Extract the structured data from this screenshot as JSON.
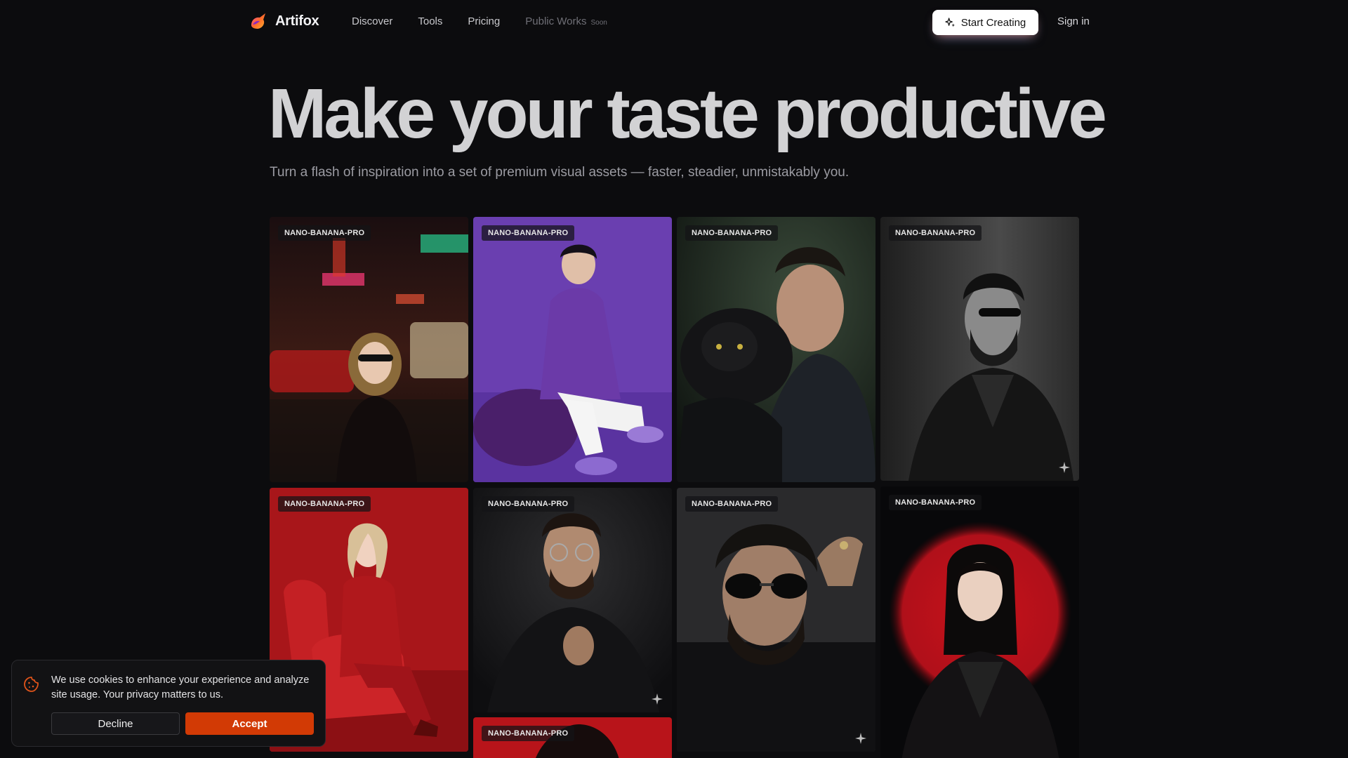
{
  "brand": {
    "name": "Artifox"
  },
  "nav": {
    "links": [
      "Discover",
      "Tools",
      "Pricing"
    ],
    "public_works": "Public Works",
    "soon_badge": "Soon",
    "cta_label": "Start Creating",
    "signin_label": "Sign in"
  },
  "hero": {
    "title": "Make your taste productive",
    "subtitle": "Turn a flash of inspiration into a set of premium visual assets — faster, steadier, unmistakably you."
  },
  "gallery": {
    "items": [
      {
        "model": "NANO-BANANA-PRO",
        "subject": "neon street portrait"
      },
      {
        "model": "NANO-BANANA-PRO",
        "subject": "purple studio portrait"
      },
      {
        "model": "NANO-BANANA-PRO",
        "subject": "man with black panther"
      },
      {
        "model": "NANO-BANANA-PRO",
        "subject": "monochrome leather jacket portrait"
      },
      {
        "model": "NANO-BANANA-PRO",
        "subject": "red chair portrait"
      },
      {
        "model": "NANO-BANANA-PRO",
        "subject": "turtleneck glasses portrait"
      },
      {
        "model": "NANO-BANANA-PRO",
        "subject": "sunglasses portrait"
      },
      {
        "model": "NANO-BANANA-PRO",
        "subject": "red halo portrait"
      },
      {
        "model": "NANO-BANANA-PRO",
        "subject": "red background portrait"
      }
    ]
  },
  "cookie": {
    "message": "We use cookies to enhance your experience and analyze site usage. Your privacy matters to us.",
    "decline_label": "Decline",
    "accept_label": "Accept"
  },
  "colors": {
    "background": "#0c0c0e",
    "accent": "#d23a05",
    "cta_bg": "#ffffff"
  },
  "icons": {
    "logo": "fox-logo-icon",
    "cta": "sparkle-icon",
    "cookie": "cookie-icon",
    "card_corner": "sparkle-icon"
  }
}
